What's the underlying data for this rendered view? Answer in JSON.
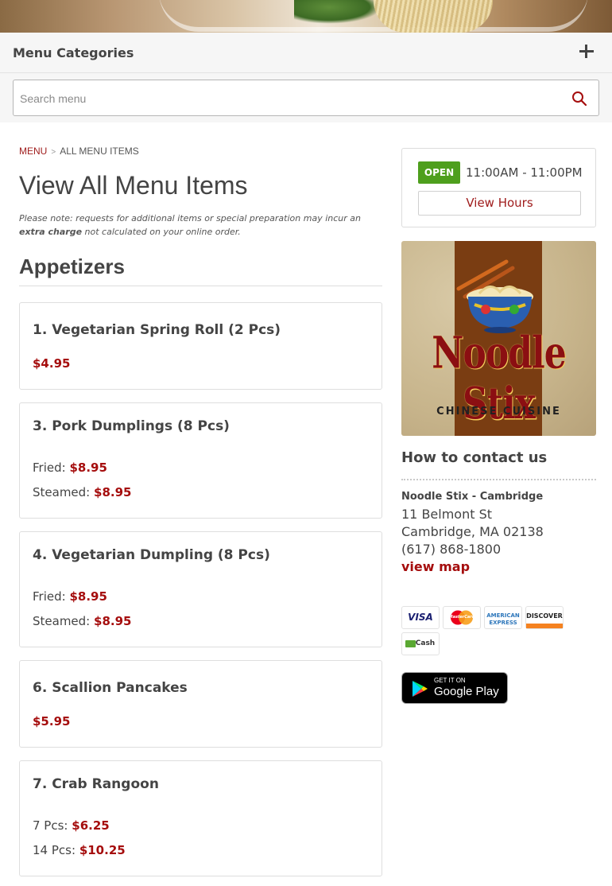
{
  "menu_categories": {
    "title": "Menu Categories"
  },
  "search": {
    "placeholder": "Search menu"
  },
  "breadcrumb": {
    "root": "MENU",
    "separator": ">",
    "current": "ALL MENU ITEMS"
  },
  "page": {
    "title": "View All Menu Items",
    "note_prefix": "Please note: requests for additional items or special preparation may incur an",
    "note_bold": "extra charge",
    "note_suffix": "not calculated on your online order."
  },
  "section": {
    "title": "Appetizers"
  },
  "items": [
    {
      "name": "1. Vegetarian Spring Roll (2 Pcs)",
      "price": "$4.95"
    },
    {
      "name": "3. Pork Dumplings (8 Pcs)",
      "options": [
        {
          "label": "Fried:",
          "price": "$8.95"
        },
        {
          "label": "Steamed:",
          "price": "$8.95"
        }
      ]
    },
    {
      "name": "4. Vegetarian Dumpling (8 Pcs)",
      "options": [
        {
          "label": "Fried:",
          "price": "$8.95"
        },
        {
          "label": "Steamed:",
          "price": "$8.95"
        }
      ]
    },
    {
      "name": "6. Scallion Pancakes",
      "price": "$5.95"
    },
    {
      "name": "7. Crab Rangoon",
      "options": [
        {
          "label": "7 Pcs:",
          "price": "$6.25"
        },
        {
          "label": "14 Pcs:",
          "price": "$10.25"
        }
      ]
    }
  ],
  "hours": {
    "status": "OPEN",
    "time": "11:00AM - 11:00PM",
    "button": "View Hours",
    "status_color": "#4e9f1d"
  },
  "logo": {
    "wordmark": "Noodle Stix",
    "subtitle": "CHINESE CUISINE"
  },
  "contact": {
    "title": "How to contact us",
    "name": "Noodle Stix - Cambridge",
    "street": "11 Belmont St",
    "city": "Cambridge, MA 02138",
    "phone": "(617) 868-1800",
    "map_link": "view map"
  },
  "payments": [
    {
      "name": "VISA",
      "icon": "visa-icon"
    },
    {
      "name": "MasterCard",
      "icon": "mastercard-icon"
    },
    {
      "name": "AMERICAN EXPRESS",
      "icon": "amex-icon"
    },
    {
      "name": "DISCOVER",
      "icon": "discover-icon"
    },
    {
      "name": "Cash",
      "icon": "cash-icon"
    }
  ],
  "google_play": {
    "top": "GET IT ON",
    "bottom": "Google Play"
  },
  "colors": {
    "accent": "#a50d0d",
    "open_green": "#4e9f1d",
    "bar_bg": "#f6f6f6"
  }
}
